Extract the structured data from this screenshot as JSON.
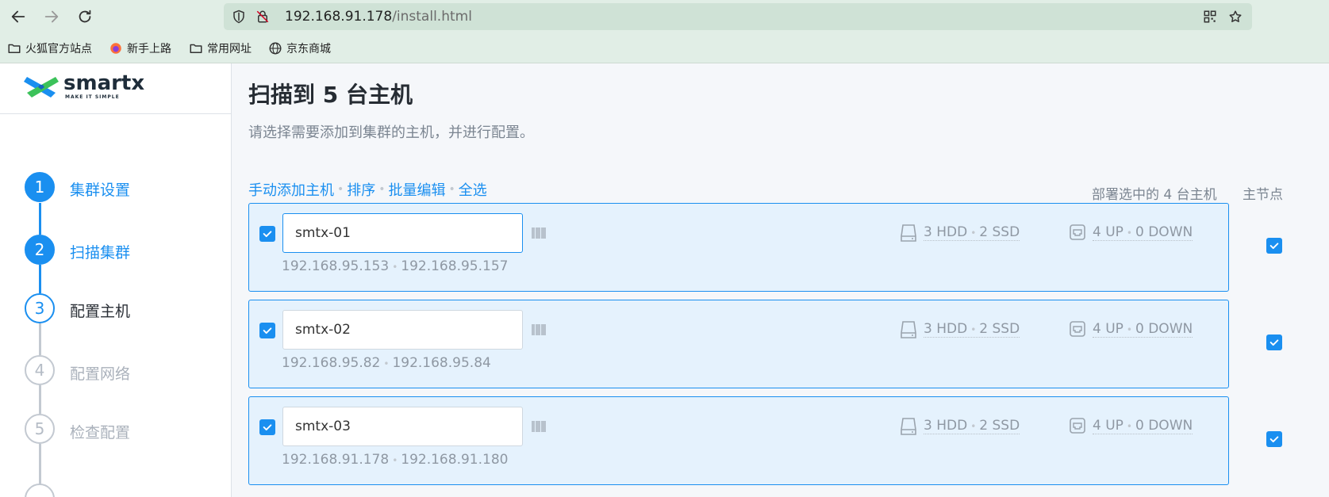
{
  "browser": {
    "url_host": "192.168.91.178",
    "url_path": "/install.html",
    "icons": [
      "back-icon",
      "forward-icon",
      "reload-icon",
      "shield-icon",
      "insecure-lock-icon",
      "qr-code-icon",
      "star-icon"
    ],
    "bookmarks": [
      {
        "label": "火狐官方站点",
        "icon": "folder-icon"
      },
      {
        "label": "新手上路",
        "icon": "firefox-icon"
      },
      {
        "label": "常用网址",
        "icon": "folder-icon"
      },
      {
        "label": "京东商城",
        "icon": "globe-icon"
      }
    ]
  },
  "brand": {
    "name": "smartx",
    "tagline": "MAKE IT SIMPLE",
    "colors": {
      "blue": "#1a8ff0",
      "green": "#3cc25a"
    }
  },
  "steps": [
    {
      "num": "1",
      "label": "集群设置",
      "state": "done"
    },
    {
      "num": "2",
      "label": "扫描集群",
      "state": "done"
    },
    {
      "num": "3",
      "label": "配置主机",
      "state": "active"
    },
    {
      "num": "4",
      "label": "配置网络",
      "state": "todo"
    },
    {
      "num": "5",
      "label": "检查配置",
      "state": "todo"
    }
  ],
  "main": {
    "title": "扫描到 5 台主机",
    "subtitle": "请选择需要添加到集群的主机，并进行配置。",
    "actions": [
      "手动添加主机",
      "排序",
      "批量编辑",
      "全选"
    ],
    "deploy_count": "部署选中的 4 台主机",
    "master_header": "主节点"
  },
  "hosts": [
    {
      "name": "smtx-01",
      "ip1": "192.168.95.153",
      "ip2": "192.168.95.157",
      "hdd": "3 HDD",
      "ssd": "2 SSD",
      "up": "4 UP",
      "down": "0 DOWN",
      "selected": true,
      "master": true,
      "focused": true
    },
    {
      "name": "smtx-02",
      "ip1": "192.168.95.82",
      "ip2": "192.168.95.84",
      "hdd": "3 HDD",
      "ssd": "2 SSD",
      "up": "4 UP",
      "down": "0 DOWN",
      "selected": true,
      "master": true,
      "focused": false
    },
    {
      "name": "smtx-03",
      "ip1": "192.168.91.178",
      "ip2": "192.168.91.180",
      "hdd": "3 HDD",
      "ssd": "2 SSD",
      "up": "4 UP",
      "down": "0 DOWN",
      "selected": true,
      "master": true,
      "focused": false
    }
  ]
}
